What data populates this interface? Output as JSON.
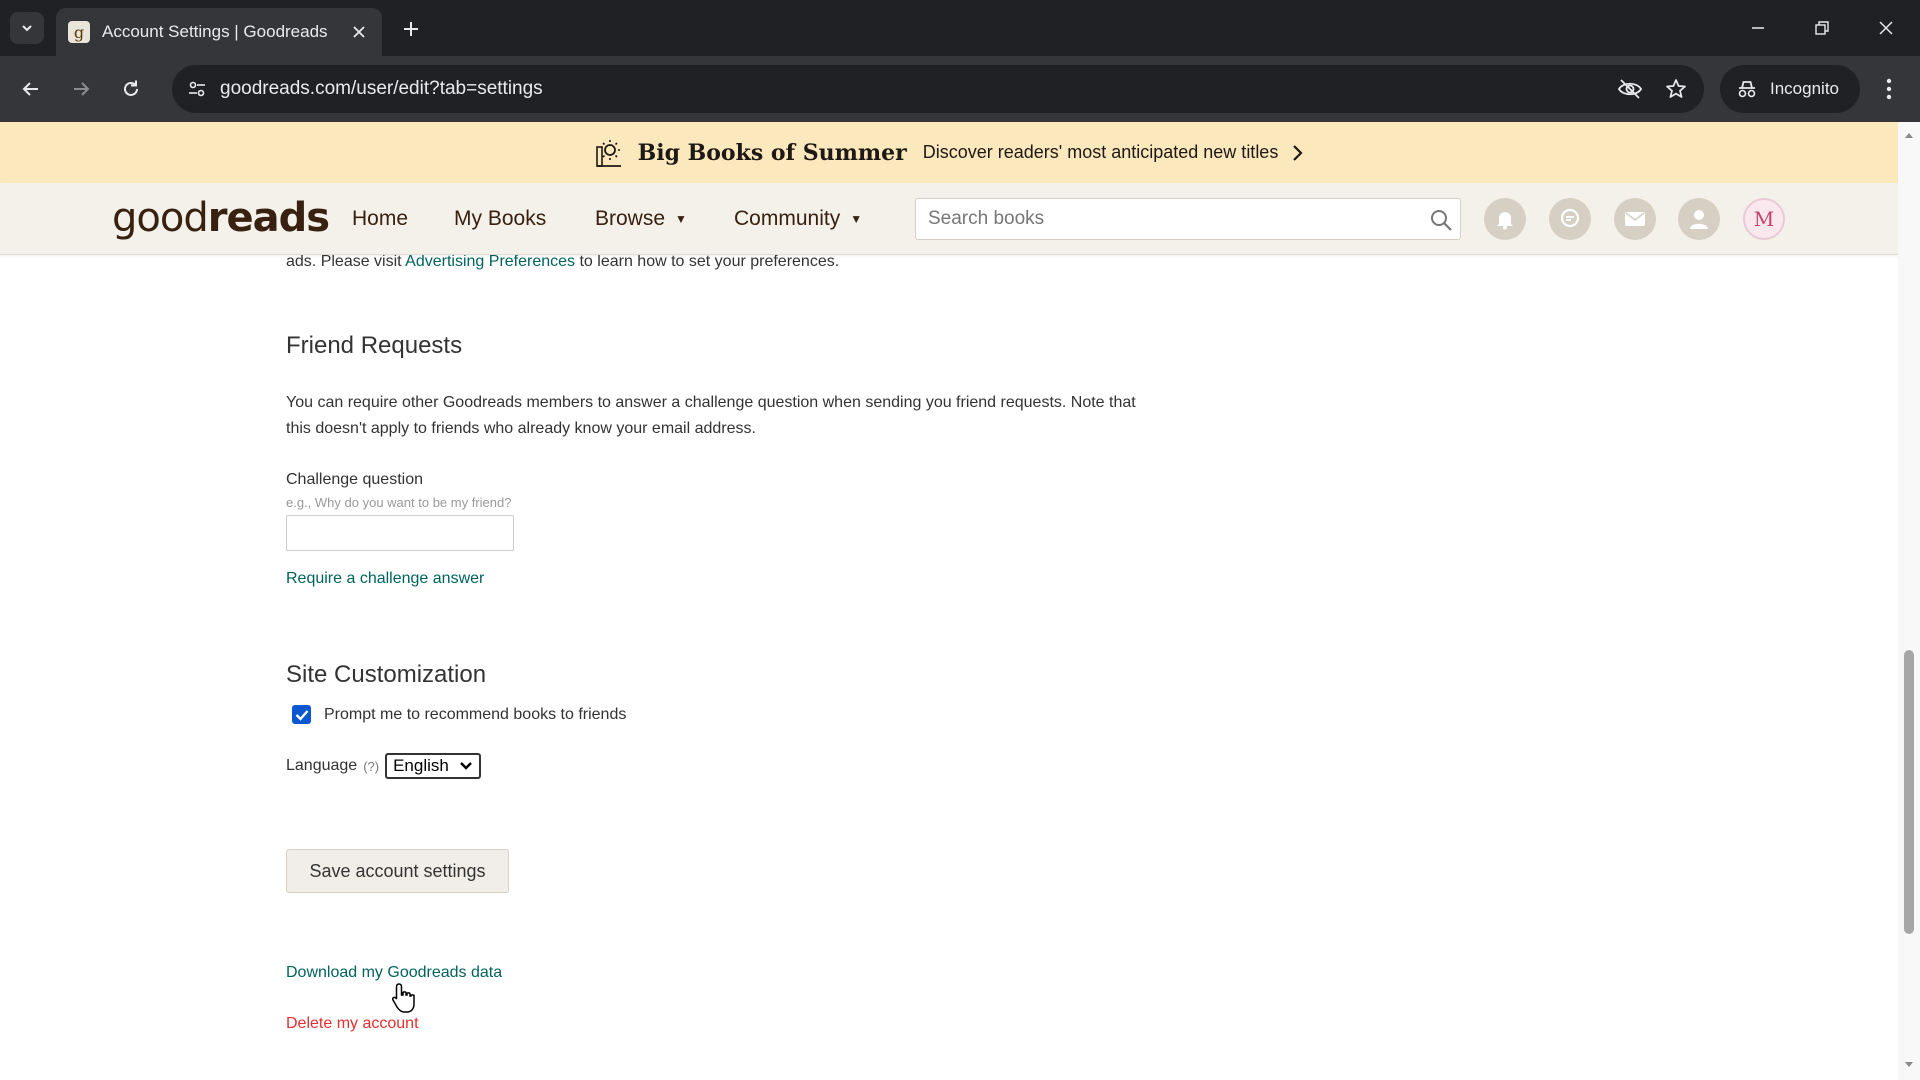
{
  "browser": {
    "tab_title": "Account Settings | Goodreads",
    "tab_favicon_letter": "g",
    "url": "goodreads.com/user/edit?tab=settings",
    "incognito_label": "Incognito"
  },
  "promo": {
    "title": "Big Books of Summer",
    "text": "Discover readers' most anticipated new titles"
  },
  "header": {
    "logo_light": "good",
    "logo_bold": "reads",
    "nav": {
      "home": "Home",
      "my_books": "My Books",
      "browse": "Browse",
      "community": "Community",
      "caret": "▼"
    },
    "search_placeholder": "Search books",
    "avatar_letter": "M"
  },
  "ads_note": {
    "prefix": "ads. Please visit ",
    "link": "Advertising Preferences",
    "suffix": " to learn how to set your preferences."
  },
  "friend_requests": {
    "heading": "Friend Requests",
    "description": "You can require other Goodreads members to answer a challenge question when sending you friend requests. Note that this doesn't apply to friends who already know your email address.",
    "challenge_label": "Challenge question",
    "challenge_hint": "e.g., Why do you want to be my friend?",
    "challenge_value": "",
    "require_link": "Require a challenge answer"
  },
  "site_customization": {
    "heading": "Site Customization",
    "recommend_label": "Prompt me to recommend books to friends",
    "recommend_checked": true,
    "language_label": "Language",
    "language_help": "(?)",
    "language_value": "English"
  },
  "actions": {
    "save": "Save account settings",
    "download": "Download my Goodreads data",
    "delete": "Delete my account"
  },
  "colors": {
    "promo_bg": "#fce8bd",
    "header_bg": "#f4f1ea",
    "link": "#00635d",
    "danger": "#e3302f"
  }
}
